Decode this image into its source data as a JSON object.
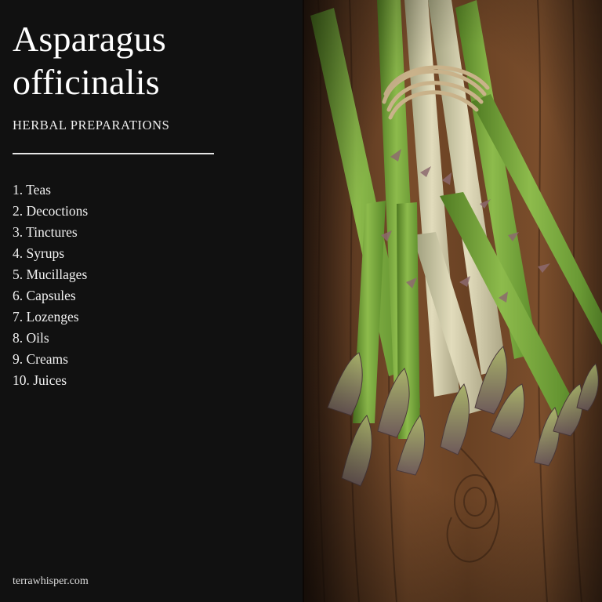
{
  "title_line1": "Asparagus",
  "title_line2": "officinalis",
  "subtitle": "HERBAL PREPARATIONS",
  "items": [
    "1. Teas",
    "2. Decoctions",
    "3. Tinctures",
    "4. Syrups",
    "5. Mucillages",
    "6. Capsules",
    "7. Lozenges",
    "8. Oils",
    "9. Creams",
    "10. Juices"
  ],
  "footer": "terrawhisper.com",
  "photo": {
    "subject": "asparagus-bundle",
    "colors": {
      "wood_dark": "#3a2416",
      "wood_light": "#8a5a34",
      "stalk_green": "#7fae3e",
      "stalk_pale": "#d9d5b4",
      "tip_purple": "#8a6a6a",
      "twine": "#c9b28a"
    }
  }
}
